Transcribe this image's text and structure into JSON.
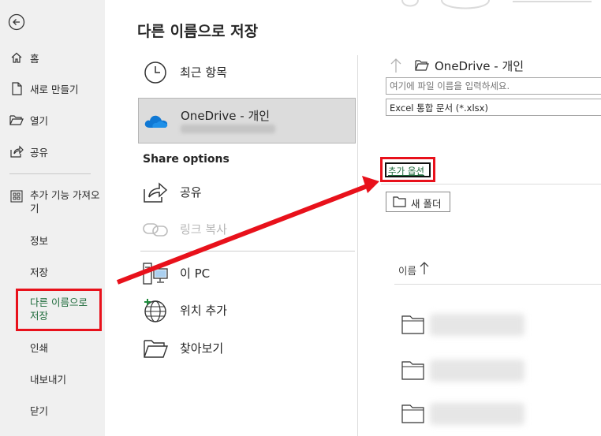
{
  "nav": {
    "back_icon": "arrow-left-circle-icon",
    "items": {
      "home": "홈",
      "new": "새로 만들기",
      "open": "열기",
      "share": "공유",
      "addins": "추가 기능 가져오기",
      "info": "정보",
      "save": "저장",
      "saveas": "다른 이름으로 저장",
      "print": "인쇄",
      "export": "내보내기",
      "close": "닫기"
    }
  },
  "main": {
    "title": "다른 이름으로 저장",
    "locations": {
      "recent": "최근 항목",
      "onedrive": "OneDrive - 개인"
    },
    "share_options": {
      "heading": "Share options",
      "share": "공유",
      "copy_link": "링크 복사"
    },
    "other_locations": {
      "this_pc": "이 PC",
      "add_place": "위치 추가",
      "browse": "찾아보기"
    }
  },
  "save_panel": {
    "path": "OneDrive - 개인",
    "filename_placeholder": "여기에 파일 이름을 입력하세요.",
    "filetype": "Excel 통합 문서 (*.xlsx)",
    "more_options": "추가 옵션",
    "new_folder": "새 폴더",
    "column_name": "이름"
  },
  "colors": {
    "accent_green": "#1e6b3b",
    "annotation_red": "#e8111b",
    "onedrive_blue": "#0f78d4"
  }
}
